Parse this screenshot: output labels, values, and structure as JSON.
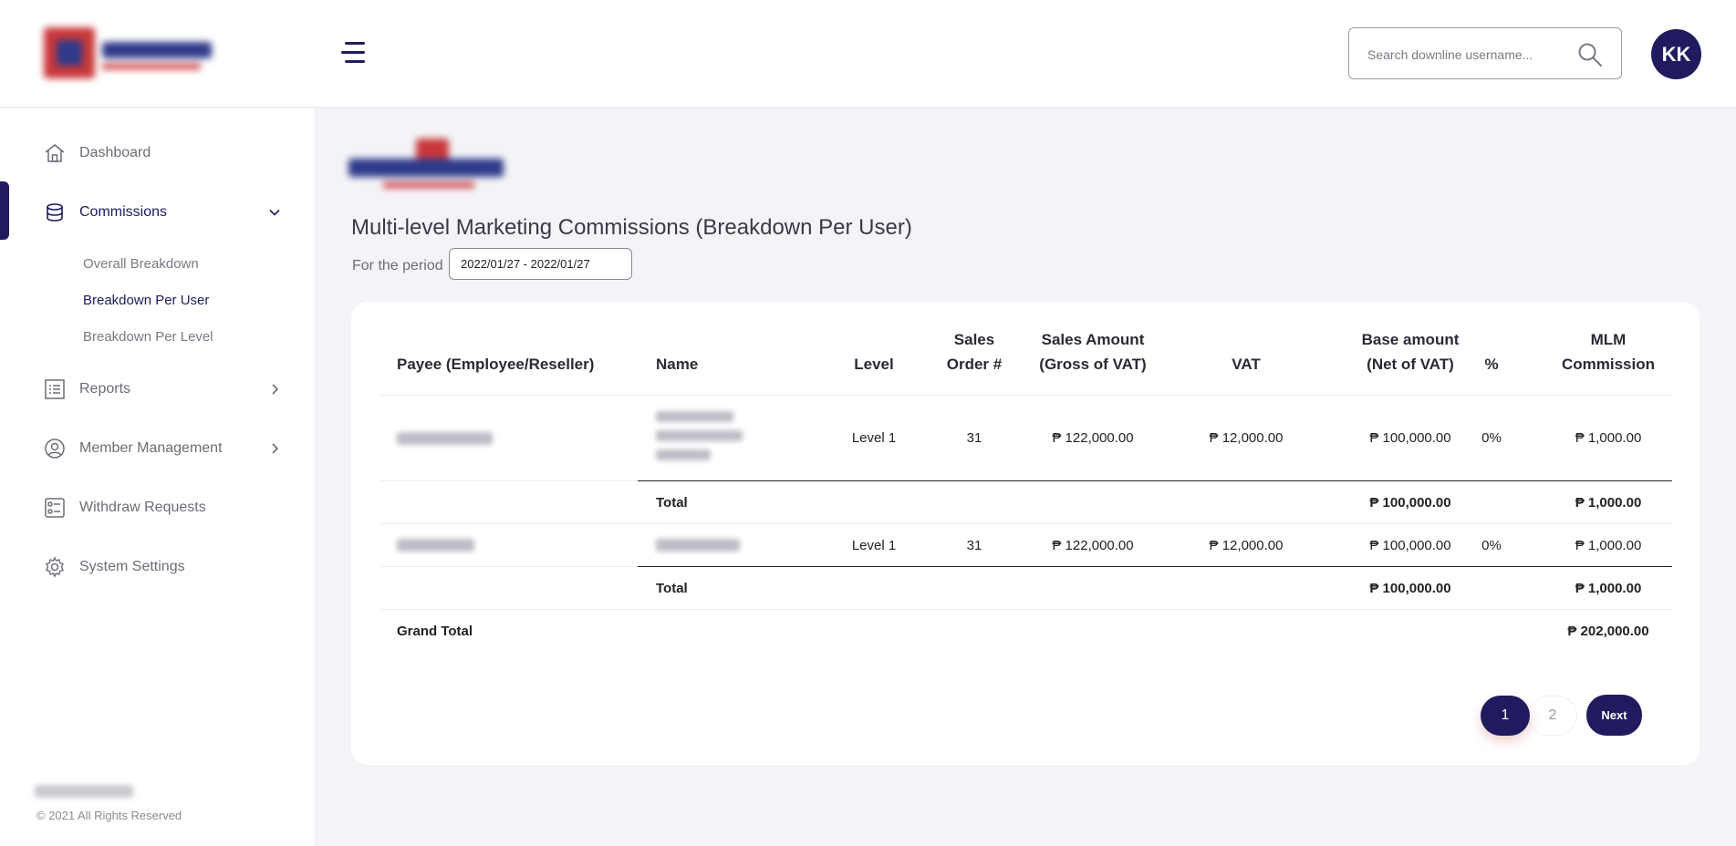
{
  "header": {
    "search_placeholder": "Search downline username...",
    "avatar_initials": "KK"
  },
  "sidebar": {
    "items": [
      {
        "label": "Dashboard"
      },
      {
        "label": "Commissions"
      },
      {
        "label": "Reports"
      },
      {
        "label": "Member Management"
      },
      {
        "label": "Withdraw Requests"
      },
      {
        "label": "System Settings"
      }
    ],
    "commissions_sub": [
      {
        "label": "Overall Breakdown"
      },
      {
        "label": "Breakdown Per User"
      },
      {
        "label": "Breakdown Per Level"
      }
    ],
    "copyright": "© 2021 All Rights Reserved"
  },
  "main": {
    "title": "Multi-level Marketing Commissions (Breakdown Per User)",
    "period_label": "For the period",
    "period_value": "2022/01/27 - 2022/01/27"
  },
  "table": {
    "headers": {
      "payee": "Payee (Employee/Reseller)",
      "name": "Name",
      "level": "Level",
      "sales_order_1": "Sales",
      "sales_order_2": "Order #",
      "sales_amount_1": "Sales Amount",
      "sales_amount_2": "(Gross of VAT)",
      "vat": "VAT",
      "base_amount_1": "Base amount",
      "base_amount_2": "(Net of VAT)",
      "percent": "%",
      "mlm_1": "MLM",
      "mlm_2": "Commission"
    },
    "rows": [
      {
        "level": "Level 1",
        "sales_order": "31",
        "sales_amount": "₱ 122,000.00",
        "vat": "₱ 12,000.00",
        "base_amount": "₱ 100,000.00",
        "percent": "0%",
        "mlm_commission": "₱ 1,000.00",
        "total_label": "Total",
        "total_base": "₱ 100,000.00",
        "total_mlm": "₱ 1,000.00"
      },
      {
        "level": "Level 1",
        "sales_order": "31",
        "sales_amount": "₱ 122,000.00",
        "vat": "₱ 12,000.00",
        "base_amount": "₱ 100,000.00",
        "percent": "0%",
        "mlm_commission": "₱ 1,000.00",
        "total_label": "Total",
        "total_base": "₱ 100,000.00",
        "total_mlm": "₱ 1,000.00"
      }
    ],
    "grand_total_label": "Grand Total",
    "grand_total_value": "₱ 202,000.00"
  },
  "pagination": {
    "pages": [
      "1",
      "2"
    ],
    "current": "1",
    "next_label": "Next"
  },
  "colors": {
    "primary": "#1f1b5e",
    "background": "#f4f4f8",
    "card": "#ffffff"
  }
}
